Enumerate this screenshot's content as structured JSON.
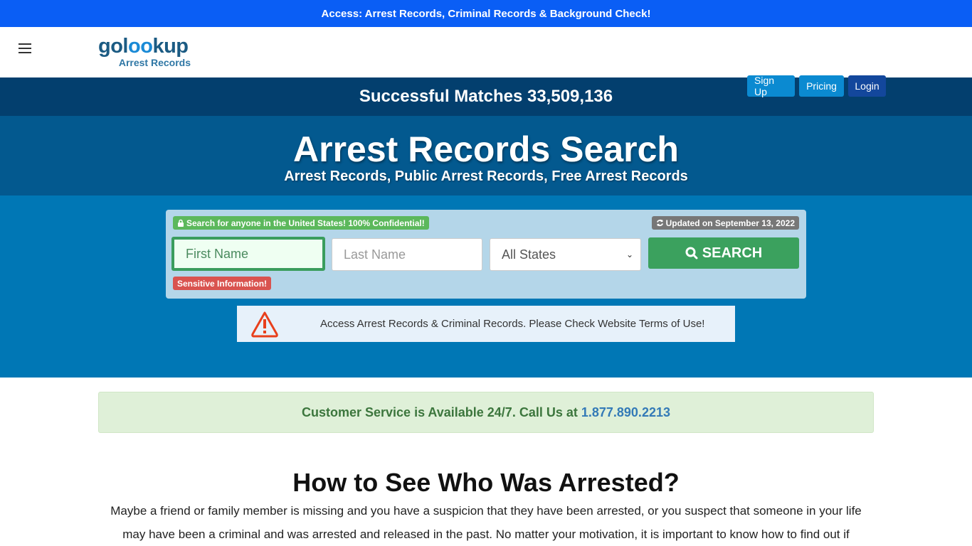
{
  "topbar": {
    "text": "Access: Arrest Records, Criminal Records & Background Check!"
  },
  "logo": {
    "pre": "gol",
    "oo": "oo",
    "post": "kup",
    "sub": "Arrest Records"
  },
  "nav": {
    "signup": "Sign Up",
    "pricing": "Pricing",
    "login": "Login"
  },
  "matches": {
    "text": "Successful Matches 33,509,136"
  },
  "hero": {
    "title": "Arrest Records Search",
    "subtitle": "Arrest Records, Public Arrest Records, Free Arrest Records"
  },
  "search": {
    "confidential_badge": "Search for anyone in the United States! 100% Confidential!",
    "updated_badge": "Updated on September 13, 2022",
    "first_name_placeholder": "First Name",
    "last_name_placeholder": "Last Name",
    "state_selected": "All States",
    "button_label": "SEARCH",
    "sensitive_badge": "Sensitive Information!"
  },
  "notice": {
    "text": "Access Arrest Records & Criminal Records. Please Check Website Terms of Use!"
  },
  "service": {
    "text": "Customer Service is Available 24/7. Call Us at",
    "phone": "1.877.890.2213"
  },
  "article": {
    "heading": "How to See Who Was Arrested?",
    "paragraph": "Maybe a friend or family member is missing and you have a suspicion that they have been arrested, or you suspect that someone in your life may have been a criminal and was arrested and released in the past. No matter your motivation, it is important to know how to find out if"
  },
  "colors": {
    "topbar": "#0a5ef5",
    "matches_bg": "#033f6e",
    "hero_bg": "#03598f",
    "search_bg": "#0077b5",
    "search_btn": "#3ba15e",
    "login_btn": "#13479c"
  }
}
